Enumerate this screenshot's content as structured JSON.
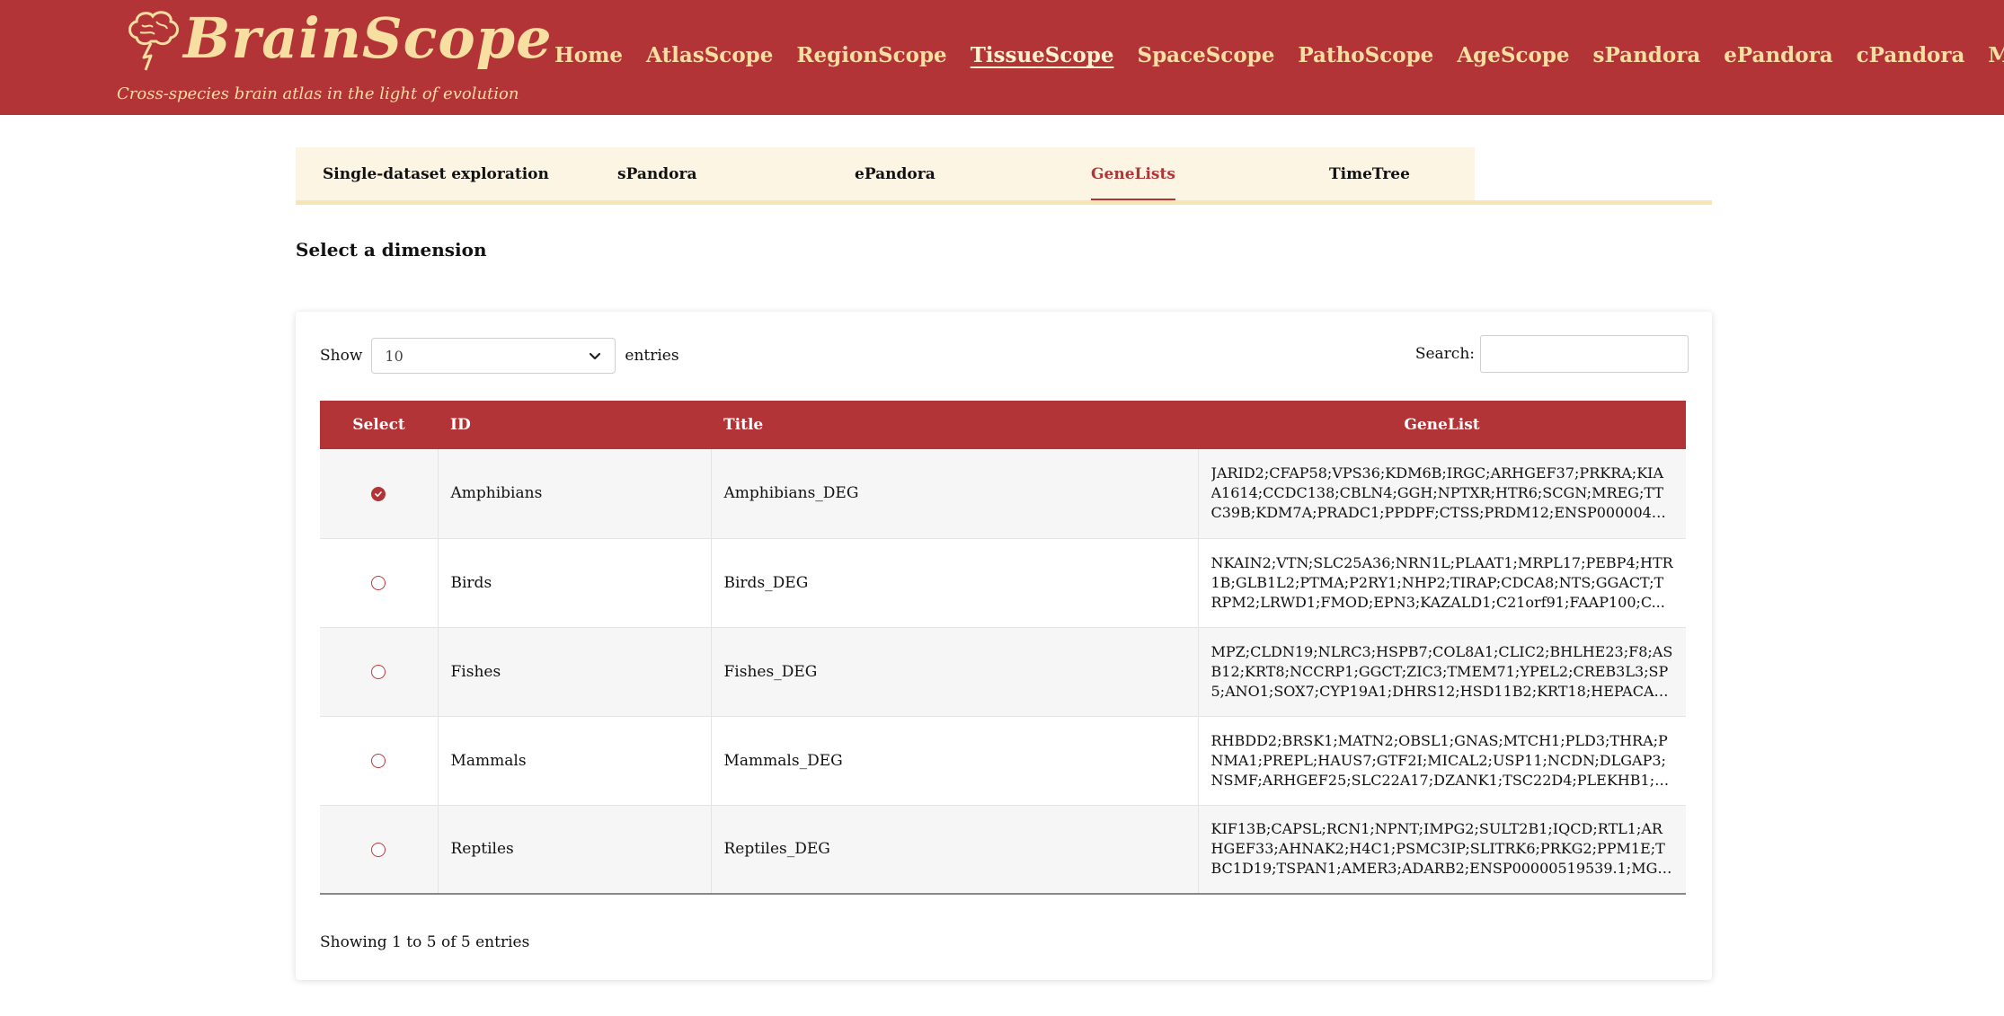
{
  "brand": {
    "title": "BrainScope",
    "subtitle": "Cross-species brain atlas in the light of evolution"
  },
  "nav": [
    {
      "label": "Home",
      "active": false
    },
    {
      "label": "AtlasScope",
      "active": false
    },
    {
      "label": "RegionScope",
      "active": false
    },
    {
      "label": "TissueScope",
      "active": true
    },
    {
      "label": "SpaceScope",
      "active": false
    },
    {
      "label": "PathoScope",
      "active": false
    },
    {
      "label": "AgeScope",
      "active": false
    },
    {
      "label": "sPandora",
      "active": false
    },
    {
      "label": "ePandora",
      "active": false
    },
    {
      "label": "cPandora",
      "active": false
    },
    {
      "label": "More",
      "active": false
    }
  ],
  "subtabs": [
    {
      "label": "Single-dataset exploration",
      "active": false
    },
    {
      "label": "sPandora",
      "active": false
    },
    {
      "label": "ePandora",
      "active": false
    },
    {
      "label": "GeneLists",
      "active": true
    },
    {
      "label": "TimeTree",
      "active": false
    }
  ],
  "dimension_label": "Select a dimension",
  "length_control": {
    "show_label": "Show",
    "selected": "10",
    "entries_label": "entries"
  },
  "search": {
    "label": "Search:",
    "value": ""
  },
  "table": {
    "headers": [
      "Select",
      "ID",
      "Title",
      "GeneList"
    ],
    "rows": [
      {
        "selected": true,
        "id": "Amphibians",
        "title": "Amphibians_DEG",
        "genes": "JARID2;CFAP58;VPS36;KDM6B;IRGC;ARHGEF37;PRKRA;KIAA1614;CCDC138;CBLN4;GGH;NPTXR;HTR6;SCGN;MREG;TTC39B;KDM7A;PRADC1;PPDPF;CTSS;PRDM12;ENSP000004834..."
      },
      {
        "selected": false,
        "id": "Birds",
        "title": "Birds_DEG",
        "genes": "NKAIN2;VTN;SLC25A36;NRN1L;PLAAT1;MRPL17;PEBP4;HTR1B;GLB1L2;PTMA;P2RY1;NHP2;TIRAP;CDCA8;NTS;GGACT;TRPM2;LRWD1;FMOD;EPN3;KAZALD1;C21orf91;FAAP100;C..."
      },
      {
        "selected": false,
        "id": "Fishes",
        "title": "Fishes_DEG",
        "genes": "MPZ;CLDN19;NLRC3;HSPB7;COL8A1;CLIC2;BHLHE23;F8;ASB12;KRT8;NCCRP1;GGCT;ZIC3;TMEM71;YPEL2;CREB3L3;SP5;ANO1;SOX7;CYP19A1;DHRS12;HSD11B2;KRT18;HEPACAM..."
      },
      {
        "selected": false,
        "id": "Mammals",
        "title": "Mammals_DEG",
        "genes": "RHBDD2;BRSK1;MATN2;OBSL1;GNAS;MTCH1;PLD3;THRA;PNMA1;PREPL;HAUS7;GTF2I;MICAL2;USP11;NCDN;DLGAP3;NSMF;ARHGEF25;SLC22A17;DZANK1;TSC22D4;PLEKHB1;PF..."
      },
      {
        "selected": false,
        "id": "Reptiles",
        "title": "Reptiles_DEG",
        "genes": "KIF13B;CAPSL;RCN1;NPNT;IMPG2;SULT2B1;IQCD;RTL1;ARHGEF33;AHNAK2;H4C1;PSMC3IP;SLITRK6;PRKG2;PPM1E;TBC1D19;TSPAN1;AMER3;ADARB2;ENSP00000519539.1;MGMT;..."
      }
    ]
  },
  "footer_info": "Showing 1 to 5 of 5 entries",
  "colors": {
    "brand_red": "#b33437",
    "brand_cream": "#f7dfa2",
    "tab_bg": "#fdf5e4"
  }
}
